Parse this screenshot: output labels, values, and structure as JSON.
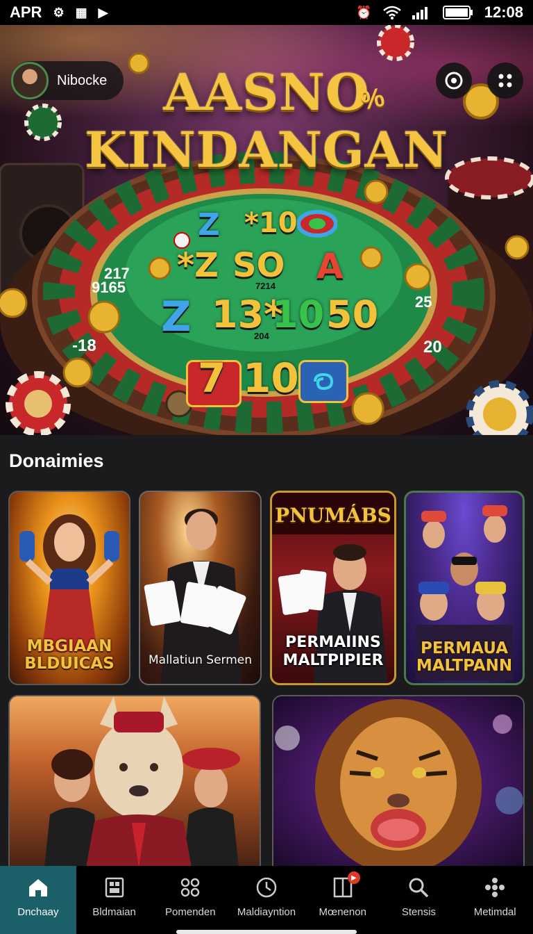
{
  "status_bar": {
    "carrier": "APR",
    "time": "12:08"
  },
  "profile": {
    "name": "Nibocke"
  },
  "hero": {
    "title_line1": "AASNO",
    "title_line2": "KINDANGAN",
    "percent_badge": "%",
    "tiles": {
      "row1": [
        "Z",
        "*10"
      ],
      "row2": [
        "*Z",
        "SO",
        "A"
      ],
      "row2_small": "7214",
      "row3": [
        "Z",
        "13*",
        "10",
        "50"
      ],
      "row3_small": "204",
      "row4": [
        "7",
        "10"
      ]
    },
    "wheel_numbers": [
      "217",
      "9165",
      "-18",
      "25",
      "20"
    ]
  },
  "section": {
    "title": "Donaimies"
  },
  "games": [
    {
      "label_line1": "MBGIAAN",
      "label_line2": "BLDUICAS"
    },
    {
      "label": "Mallatiun Sermen"
    },
    {
      "top_title": "PNUMÁBS",
      "label_line1": "PERMAIINS",
      "label_line2": "MALTPIPIER"
    },
    {
      "label_line1": "PERMAUA",
      "label_line2": "MALTPANN"
    }
  ],
  "nav": [
    {
      "label": "Dnchaay",
      "icon": "home-icon"
    },
    {
      "label": "Bldmaian",
      "icon": "film-icon"
    },
    {
      "label": "Pomenden",
      "icon": "grid-icon"
    },
    {
      "label": "Maldiayntion",
      "icon": "clock-icon"
    },
    {
      "label": "Mœnenon",
      "icon": "columns-icon"
    },
    {
      "label": "Stensis",
      "icon": "search-icon"
    },
    {
      "label": "Metimdal",
      "icon": "dots-icon"
    }
  ]
}
